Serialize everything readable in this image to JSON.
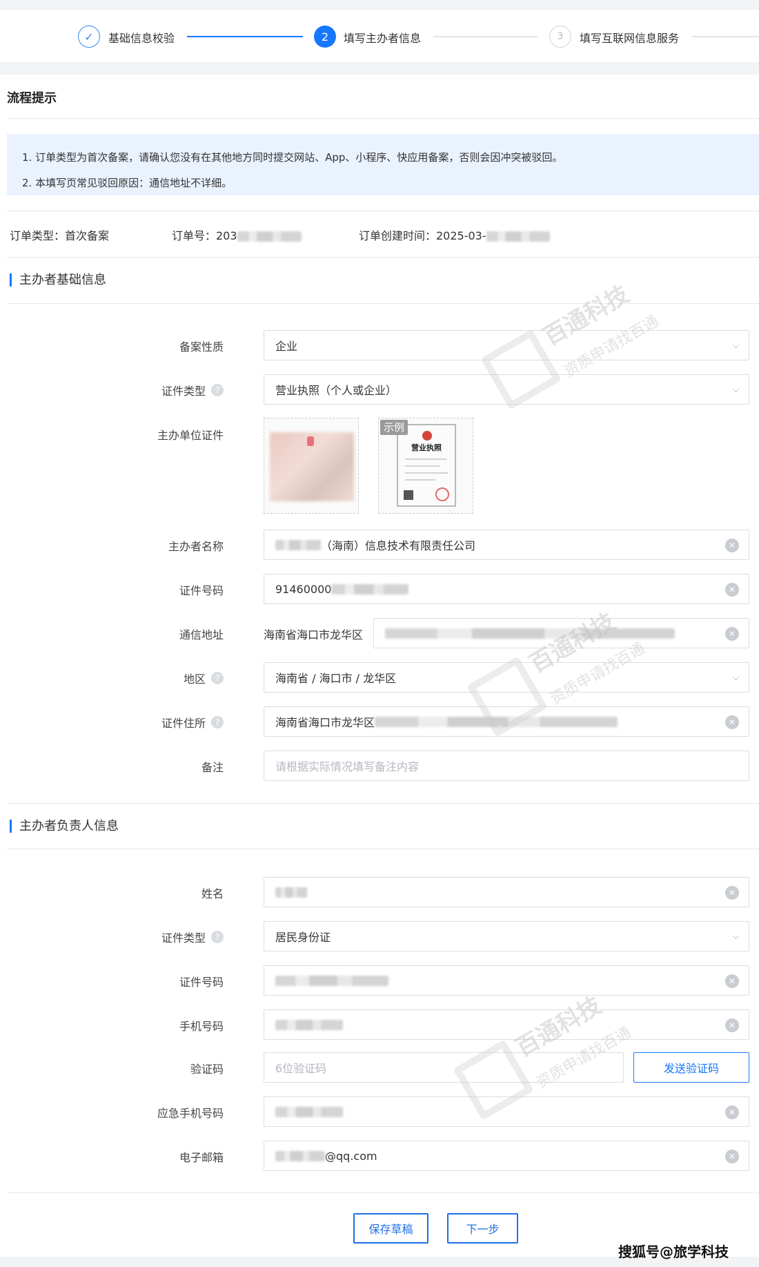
{
  "steps": [
    {
      "num": "✓",
      "label": "基础信息校验"
    },
    {
      "num": "2",
      "label": "填写主办者信息"
    },
    {
      "num": "3",
      "label": "填写互联网信息服务"
    }
  ],
  "tips": {
    "title": "流程提示",
    "line1": "1. 订单类型为首次备案，请确认您没有在其他地方同时提交网站、App、小程序、快应用备案，否则会因冲突被驳回。",
    "line2": "2. 本填写页常见驳回原因：通信地址不详细。"
  },
  "order": {
    "type": "订单类型：首次备案",
    "number": "订单号：203",
    "created": "订单创建时间：2025-03-"
  },
  "section_basic": {
    "title": "主办者基础信息",
    "nature_label": "备案性质",
    "nature_value": "企业",
    "id_type_label": "证件类型",
    "id_type_value": "营业执照（个人或企业）",
    "doc_label": "主办单位证件",
    "sample_label": "示例",
    "sample_doc_title": "营业执照",
    "name_label": "主办者名称",
    "name_value": "（海南）信息技术有限责任公司",
    "cert_no_label": "证件号码",
    "cert_no_value": "91460000",
    "addr_label": "通信地址",
    "addr_prefix": "海南省海口市龙华区",
    "region_label": "地区",
    "region_value": "海南省 / 海口市 / 龙华区",
    "cert_addr_label": "证件住所",
    "cert_addr_value": "海南省海口市龙华区",
    "remark_label": "备注",
    "remark_placeholder": "请根据实际情况填写备注内容"
  },
  "section_person": {
    "title": "主办者负责人信息",
    "name_label": "姓名",
    "id_type_label": "证件类型",
    "id_type_value": "居民身份证",
    "id_no_label": "证件号码",
    "phone_label": "手机号码",
    "code_label": "验证码",
    "code_placeholder": "6位验证码",
    "send_code": "发送验证码",
    "emergency_label": "应急手机号码",
    "email_label": "电子邮箱",
    "email_suffix": "@qq.com"
  },
  "footer": {
    "save": "保存草稿",
    "next": "下一步",
    "source": "搜狐号@旅学科技"
  },
  "watermark": {
    "brand": "百通科技",
    "slogan": "资质申请找百通"
  },
  "icons": {
    "check": "check-icon",
    "help": "help-icon",
    "chevron": "chevron-down-icon",
    "clear": "clear-icon"
  },
  "colors": {
    "primary": "#1677ff",
    "notice_bg": "#eaf2fe"
  }
}
